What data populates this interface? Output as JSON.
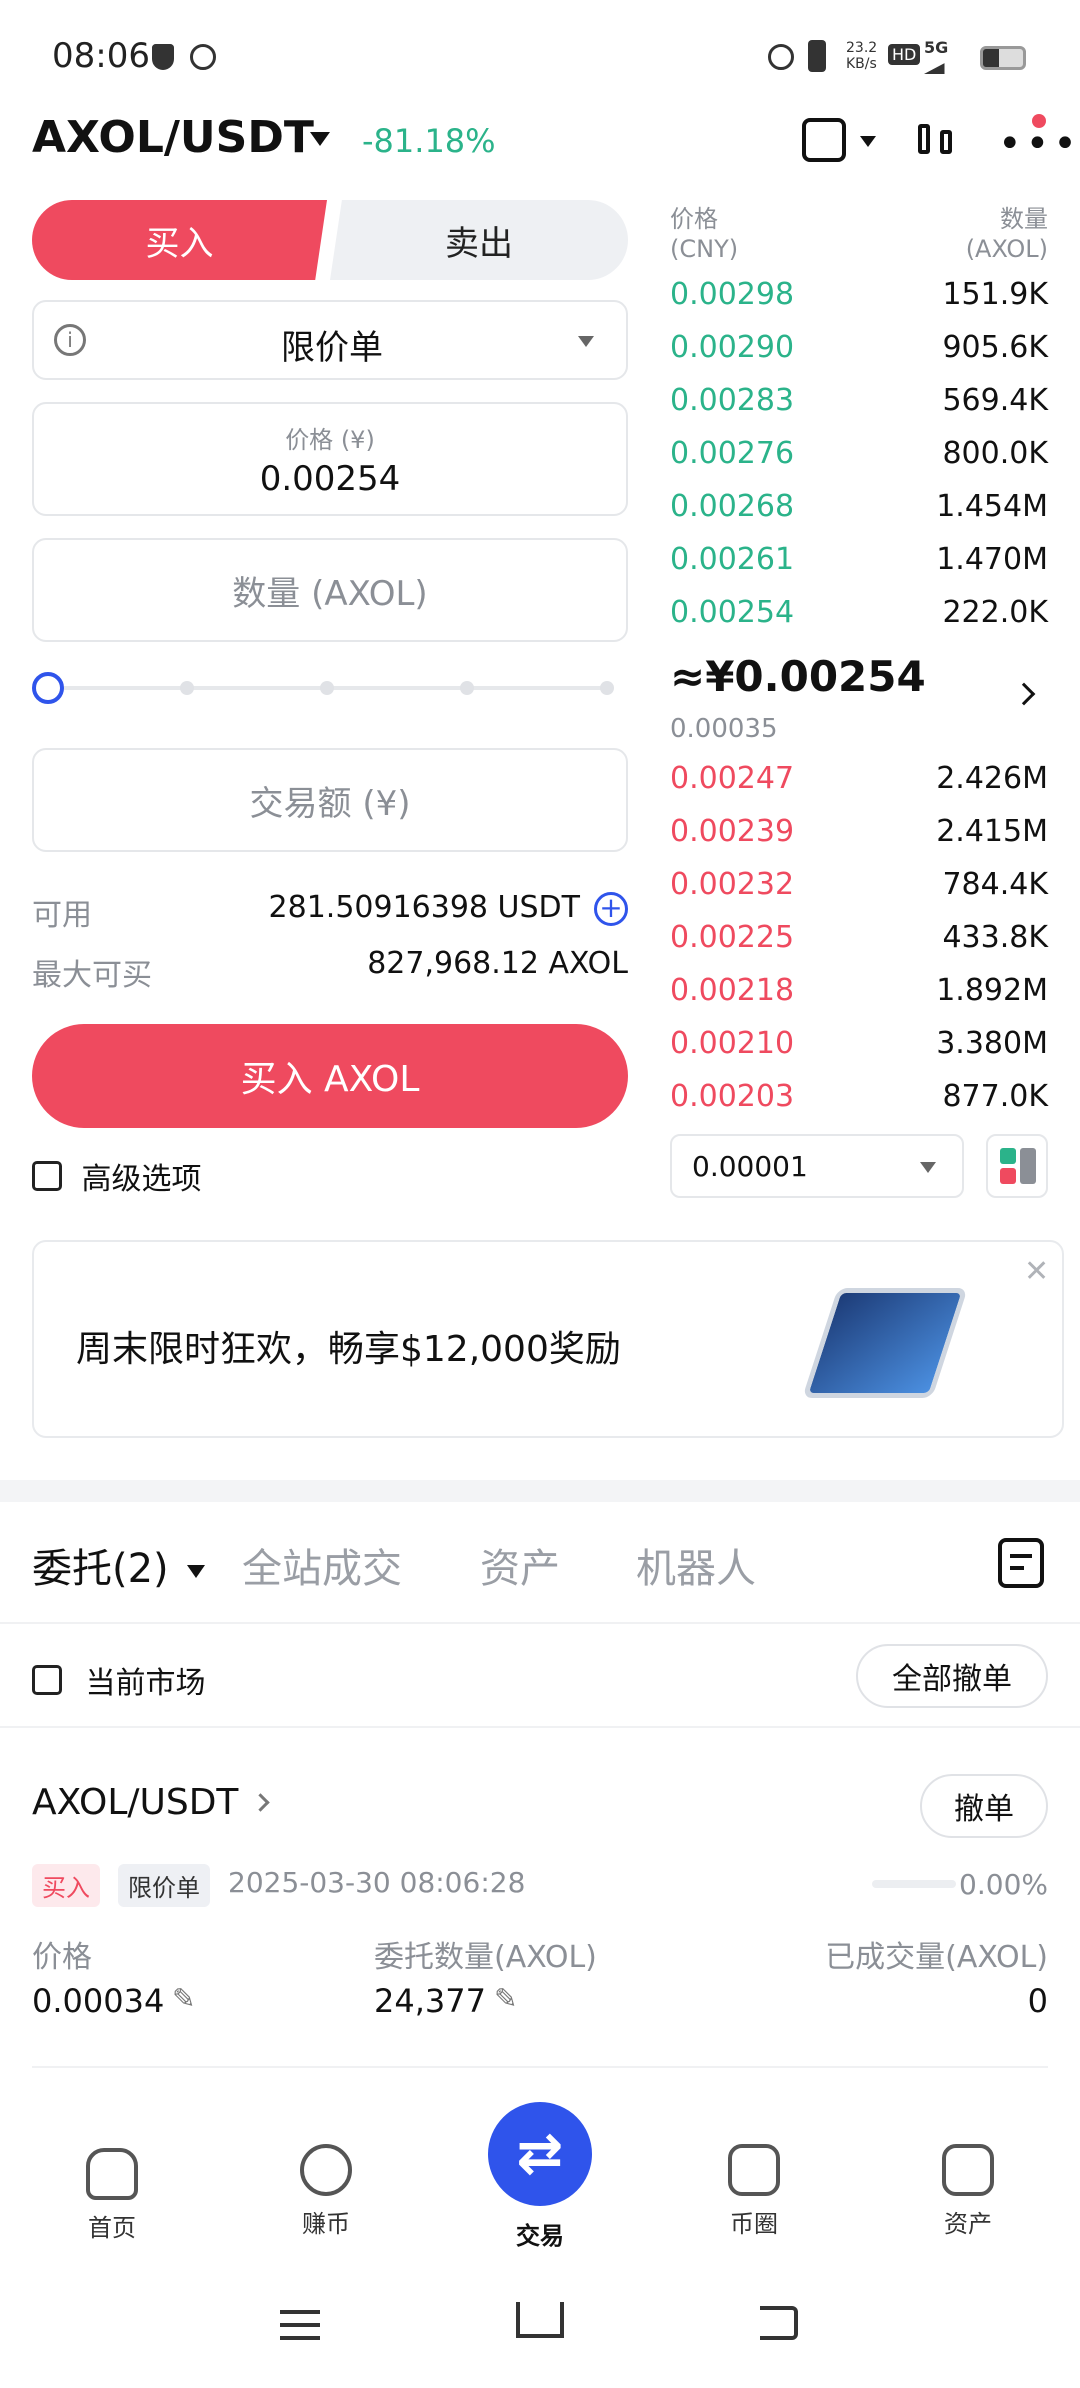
{
  "status_bar": {
    "time": "08:06",
    "net_speed": "23.2\nKB/s",
    "hd": "HD",
    "signal": "5G"
  },
  "header": {
    "pair": "AXOL/USDT",
    "change": "-81.18%"
  },
  "trade": {
    "buy_tab": "买入",
    "sell_tab": "卖出",
    "order_type": "限价单",
    "price_label": "价格 (¥)",
    "price_value": "0.00254",
    "qty_placeholder": "数量 (AXOL)",
    "amount_placeholder": "交易额 (¥)",
    "available_label": "可用",
    "available_value": "281.50916398 USDT",
    "max_buy_label": "最大可买",
    "max_buy_value": "827,968.12 AXOL",
    "buy_button": "买入 AXOL",
    "advanced_label": "高级选项"
  },
  "orderbook": {
    "price_header": "价格\n(CNY)",
    "qty_header": "数量\n(AXOL)",
    "asks": [
      {
        "price": "0.00298",
        "qty": "151.9K"
      },
      {
        "price": "0.00290",
        "qty": "905.6K"
      },
      {
        "price": "0.00283",
        "qty": "569.4K"
      },
      {
        "price": "0.00276",
        "qty": "800.0K"
      },
      {
        "price": "0.00268",
        "qty": "1.454M"
      },
      {
        "price": "0.00261",
        "qty": "1.470M"
      },
      {
        "price": "0.00254",
        "qty": "222.0K"
      }
    ],
    "last_price": "≈¥0.00254",
    "last_sub": "0.00035",
    "bids": [
      {
        "price": "0.00247",
        "qty": "2.426M"
      },
      {
        "price": "0.00239",
        "qty": "2.415M"
      },
      {
        "price": "0.00232",
        "qty": "784.4K"
      },
      {
        "price": "0.00225",
        "qty": "433.8K"
      },
      {
        "price": "0.00218",
        "qty": "1.892M"
      },
      {
        "price": "0.00210",
        "qty": "3.380M"
      },
      {
        "price": "0.00203",
        "qty": "877.0K"
      }
    ],
    "precision": "0.00001"
  },
  "banner": {
    "text": "周末限时狂欢，畅享$12,000奖励"
  },
  "orders_tabs": {
    "orders": "委托(2)",
    "trades": "全站成交",
    "assets": "资产",
    "robot": "机器人"
  },
  "orders_filter": {
    "current_market": "当前市场",
    "cancel_all": "全部撤单"
  },
  "order": {
    "pair": "AXOL/USDT",
    "cancel": "撤单",
    "side_tag": "买入",
    "type_tag": "限价单",
    "time": "2025-03-30 08:06:28",
    "progress": "0.00%",
    "price_label": "价格",
    "price_value": "0.00034",
    "qty_label": "委托数量(AXOL)",
    "qty_value": "24,377",
    "filled_label": "已成交量(AXOL)",
    "filled_value": "0"
  },
  "bottom_nav": [
    {
      "label": "首页"
    },
    {
      "label": "赚币"
    },
    {
      "label": "交易"
    },
    {
      "label": "币圈"
    },
    {
      "label": "资产"
    }
  ],
  "colors": {
    "red": "#ef4a5f",
    "green": "#2bb38a",
    "blue": "#2f54eb"
  }
}
